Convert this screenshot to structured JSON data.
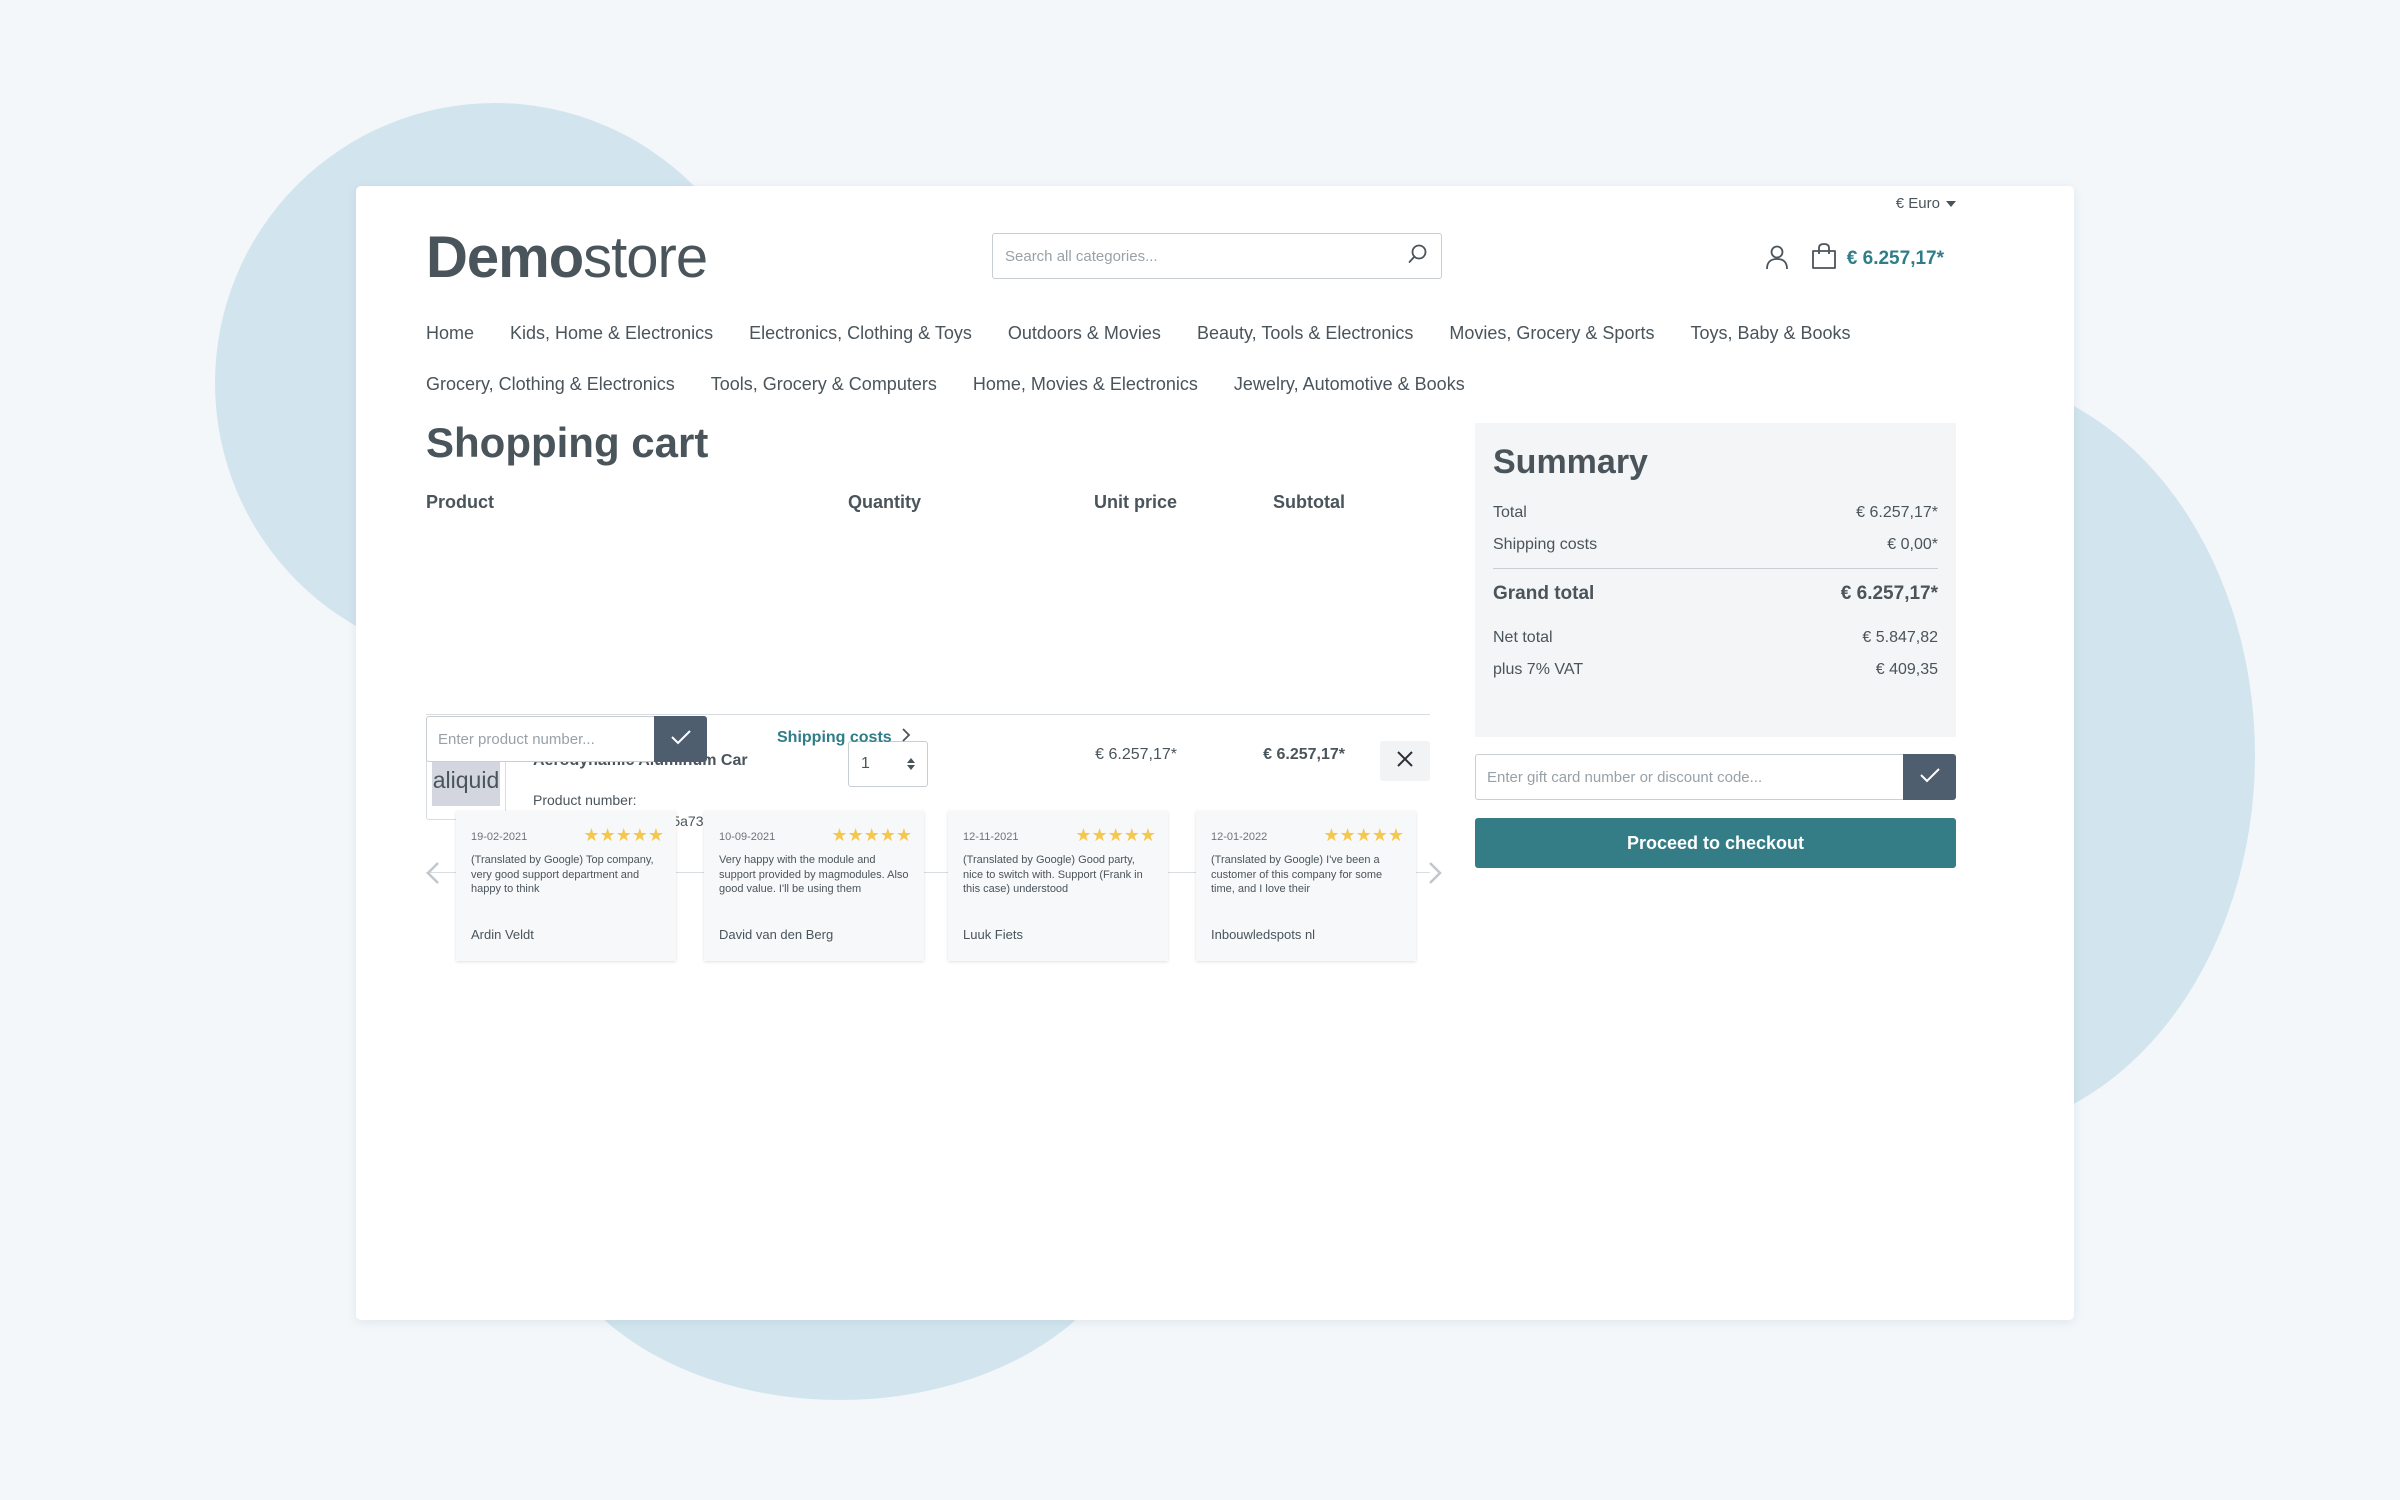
{
  "header": {
    "currency": "€ Euro",
    "logo_bold": "Demo",
    "logo_light": "store",
    "search_placeholder": "Search all categories...",
    "cart_total": "€ 6.257,17*"
  },
  "nav": {
    "row1": [
      "Home",
      "Kids, Home & Electronics",
      "Electronics, Clothing & Toys",
      "Outdoors & Movies",
      "Beauty, Tools & Electronics",
      "Movies, Grocery & Sports",
      "Toys, Baby & Books"
    ],
    "row2": [
      "Grocery, Clothing & Electronics",
      "Tools, Grocery & Computers",
      "Home, Movies & Electronics",
      "Jewelry, Automotive & Books"
    ]
  },
  "cart": {
    "title": "Shopping cart",
    "headers": {
      "product": "Product",
      "quantity": "Quantity",
      "unit_price": "Unit price",
      "subtotal": "Subtotal"
    },
    "item": {
      "image_text": "aliquid",
      "name": "Aerodynamic Aluminum Car",
      "number_label": "Product number:",
      "number": "62575692c220497d815a739d99de5389",
      "quantity": "1",
      "unit_price": "€ 6.257,17*",
      "subtotal": "€ 6.257,17*"
    },
    "add_product_placeholder": "Enter product number...",
    "shipping_link": "Shipping costs"
  },
  "reviews": [
    {
      "date": "19-02-2021",
      "stars": "★★★★★",
      "text": "(Translated by Google) Top company, very good support department and happy to think",
      "author": "Ardin Veldt"
    },
    {
      "date": "10-09-2021",
      "stars": "★★★★★",
      "text": "Very happy with the module and support provided by magmodules. Also good value. I'll be using them",
      "author": "David van den Berg"
    },
    {
      "date": "12-11-2021",
      "stars": "★★★★★",
      "text": "(Translated by Google) Good party, nice to switch with. Support (Frank in this case) understood",
      "author": "Luuk Fiets"
    },
    {
      "date": "12-01-2022",
      "stars": "★★★★★",
      "text": "(Translated by Google) I've been a customer of this company for some time, and I love their",
      "author": "Inbouwledspots nl"
    }
  ],
  "summary": {
    "title": "Summary",
    "total_label": "Total",
    "total": "€ 6.257,17*",
    "shipping_label": "Shipping costs",
    "shipping": "€ 0,00*",
    "grand_label": "Grand total",
    "grand": "€ 6.257,17*",
    "net_label": "Net total",
    "net": "€ 5.847,82",
    "vat_label": "plus 7% VAT",
    "vat": "€ 409,35"
  },
  "gift_placeholder": "Enter gift card number or discount code...",
  "checkout_label": "Proceed to checkout",
  "colors": {
    "accent": "#347d87",
    "link": "#2f7d89",
    "button_dark": "#4f5e6e",
    "stars": "#f5c84c"
  }
}
